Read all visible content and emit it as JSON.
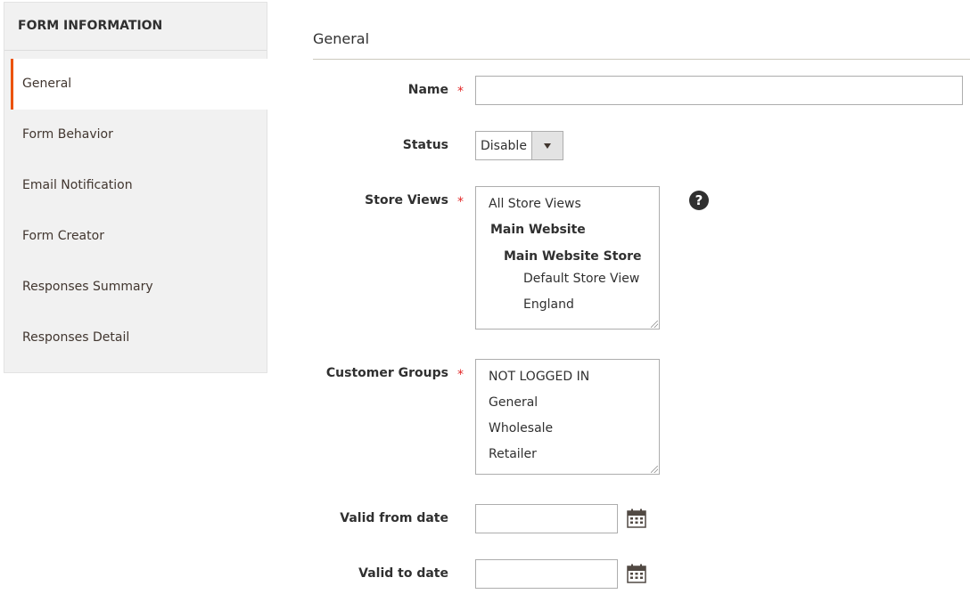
{
  "sidebar": {
    "title": "FORM INFORMATION",
    "items": [
      {
        "label": "General",
        "active": true
      },
      {
        "label": "Form Behavior"
      },
      {
        "label": "Email Notification"
      },
      {
        "label": "Form Creator"
      },
      {
        "label": "Responses Summary"
      },
      {
        "label": "Responses Detail"
      }
    ]
  },
  "main": {
    "section_title": "General",
    "required_mark": "*",
    "name": {
      "label": "Name",
      "value": ""
    },
    "status": {
      "label": "Status",
      "value": "Disable"
    },
    "store_views": {
      "label": "Store Views",
      "options": [
        "All Store Views",
        "Main Website",
        "Main Website Store",
        "Default Store View",
        "England"
      ]
    },
    "customer_groups": {
      "label": "Customer Groups",
      "options": [
        "NOT LOGGED IN",
        "General",
        "Wholesale",
        "Retailer"
      ]
    },
    "valid_from": {
      "label": "Valid from date",
      "value": ""
    },
    "valid_to": {
      "label": "Valid to date",
      "value": ""
    },
    "help_icon": "?"
  },
  "colors": {
    "accent": "#eb5202",
    "required": "#e22626"
  }
}
